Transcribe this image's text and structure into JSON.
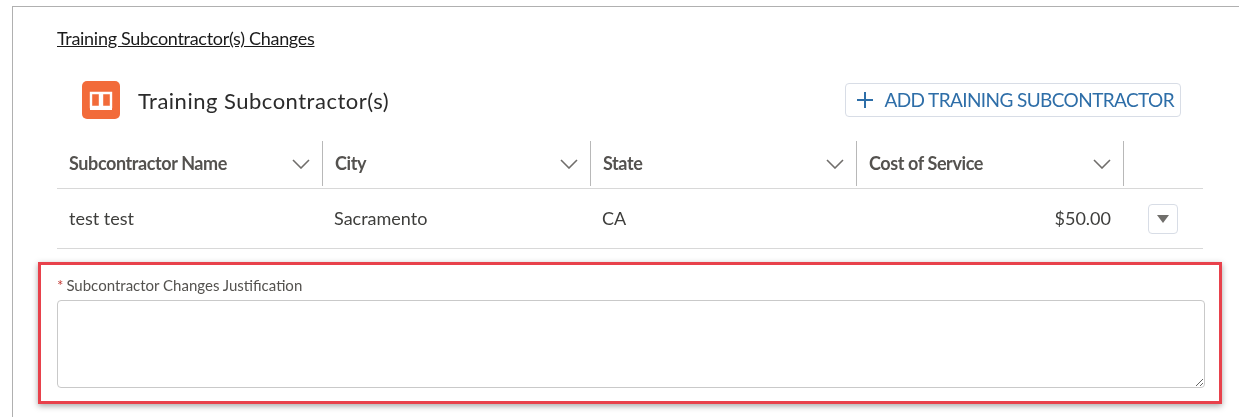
{
  "section_link": "Training Subcontractor(s) Changes",
  "card": {
    "title": "Training Subcontractor(s)",
    "add_button": "ADD TRAINING SUBCONTRACTOR"
  },
  "table": {
    "columns": [
      {
        "label": "Subcontractor Name"
      },
      {
        "label": "City"
      },
      {
        "label": "State"
      },
      {
        "label": "Cost of Service"
      }
    ],
    "rows": [
      {
        "cells": [
          "test test",
          "Sacramento",
          "CA",
          "$50.00"
        ]
      }
    ]
  },
  "justification": {
    "required_mark": "*",
    "label": "Subcontractor Changes Justification"
  }
}
